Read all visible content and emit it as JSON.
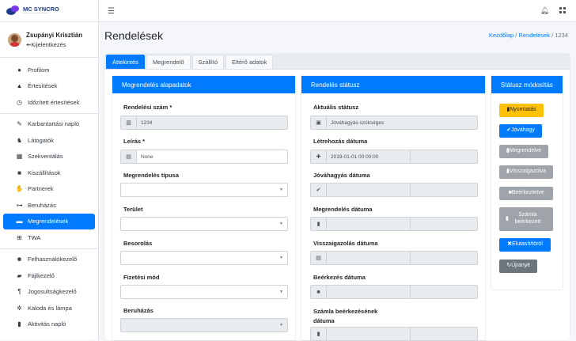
{
  "brand": {
    "name": "MC SYNCRO",
    "sub": "─────────────"
  },
  "user": {
    "name": "Zsupányi Krisztián",
    "logout": "Kijelentkezés"
  },
  "sidebar": {
    "items": [
      {
        "label": "Profilom",
        "icon": "user-icon"
      },
      {
        "label": "Értesítések",
        "icon": "bell-icon"
      },
      {
        "label": "Időzített értesítések",
        "icon": "clock-icon"
      },
      {
        "label": "Karbantartási napló",
        "icon": "wrench-icon"
      },
      {
        "label": "Látogatók",
        "icon": "visitor-icon"
      },
      {
        "label": "Szekventálás",
        "icon": "boxes-icon"
      },
      {
        "label": "Kiszállítások",
        "icon": "truck-icon"
      },
      {
        "label": "Partnerek",
        "icon": "handshake-icon"
      },
      {
        "label": "Beruházás",
        "icon": "sitemap-icon"
      },
      {
        "label": "Megrendelések",
        "icon": "cart-icon"
      },
      {
        "label": "TWA",
        "icon": "cart-icon"
      },
      {
        "label": "Felhasználókezelő",
        "icon": "users-icon"
      },
      {
        "label": "Fájlkezelő",
        "icon": "folder-icon"
      },
      {
        "label": "Jogosultságkezelő",
        "icon": "paragraph-icon"
      },
      {
        "label": "Kaloda és lámpa",
        "icon": "gear-icon"
      },
      {
        "label": "Aktivitás napló",
        "icon": "file-icon"
      }
    ]
  },
  "page": {
    "title": "Rendelések"
  },
  "breadcrumb": {
    "home": "Kezdőlap",
    "section": "Rendelések",
    "current": "1234"
  },
  "tabs": [
    "Áttekintés",
    "Megrendelő",
    "Szállító",
    "Eltérő adatok"
  ],
  "basics": {
    "title": "Megrendelés alapadatok",
    "order_no_label": "Rendelési szám *",
    "order_no": "1234",
    "desc_label": "Leírás *",
    "desc": "None",
    "type_label": "Megrendelés típusa",
    "area_label": "Terület",
    "class_label": "Besorolás",
    "pay_label": "Fizetési mód",
    "invest_label": "Beruházás"
  },
  "status": {
    "title": "Rendelés státusz",
    "current_label": "Aktuális státusz",
    "current": "Jóváhagyás szükséges",
    "created_label": "Létrehozás dátuma",
    "created": "2019-01-01 00:00:00",
    "approval_label": "Jóváhagyás dátuma",
    "order_label": "Megrendelés dátuma",
    "confirm_label": "Visszaigazolás dátuma",
    "arrival_label": "Beérkezés dátuma",
    "invoice_label": "Számla beérkezésének dátuma"
  },
  "status_mod": {
    "title": "Státusz módosítás",
    "print": "Nyomtatás",
    "approve": "Jóváhagy",
    "ordered": "Megrendelve",
    "confirmed": "Visszaigazolva",
    "arrived": "Beérkeztetve",
    "invoice": "Számla beérkezett",
    "reject": "Elutasít/töröl",
    "reopen": "Újranyit"
  },
  "colors": {
    "primary": "#007bff",
    "warning": "#ffc107",
    "secondary": "#6c757d"
  }
}
